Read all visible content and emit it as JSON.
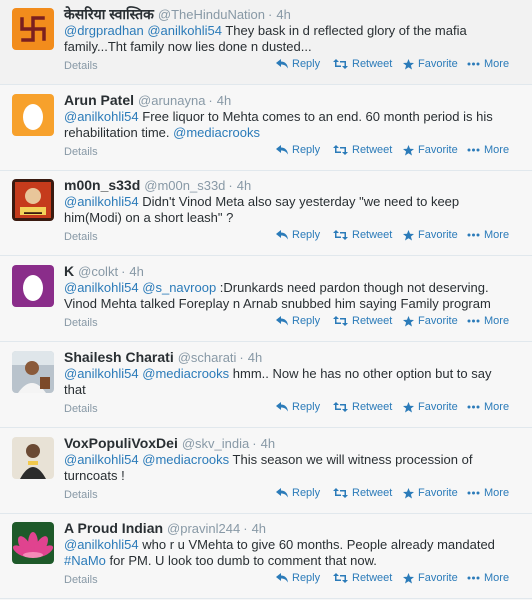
{
  "colors": {
    "link": "#2b7bb9",
    "muted": "#8899a6",
    "text": "#292f33"
  },
  "actions": {
    "reply": "Reply",
    "retweet": "Retweet",
    "favorite": "Favorite",
    "more": "More",
    "details": "Details"
  },
  "tweets": [
    {
      "name": "केसरिया स्वास्तिक",
      "handle": "@TheHinduNation",
      "time": "4h",
      "avatar": "swastika-orange",
      "segments": [
        {
          "t": "@drgpradhan",
          "link": true
        },
        {
          "t": " "
        },
        {
          "t": "@anilkohli54",
          "link": true
        },
        {
          "t": " They bask in d reflected glory of the mafia family...Tht family now lies done n dusted..."
        }
      ]
    },
    {
      "name": "Arun Patel",
      "handle": "@arunayna",
      "time": "4h",
      "avatar": "egg-orange",
      "segments": [
        {
          "t": "@anilkohli54",
          "link": true
        },
        {
          "t": " Free liquor to Mehta comes to an end. 60 month period is his rehabilitation time. "
        },
        {
          "t": "@mediacrooks",
          "link": true
        }
      ]
    },
    {
      "name": "m00n_s33d",
      "handle": "@m00n_s33d",
      "time": "4h",
      "avatar": "photo-poster",
      "segments": [
        {
          "t": "@anilkohli54",
          "link": true
        },
        {
          "t": " Didn't Vinod Meta also say yesterday \"we need to keep him(Modi) on a short leash\" ?"
        }
      ]
    },
    {
      "name": "K",
      "handle": "@colkt",
      "time": "4h",
      "avatar": "egg-purple",
      "segments": [
        {
          "t": "@anilkohli54",
          "link": true
        },
        {
          "t": " "
        },
        {
          "t": "@s_navroop",
          "link": true
        },
        {
          "t": " :Drunkards need pardon though not deserving. Vinod Mehta talked Foreplay n Arnab snubbed him saying Family program"
        }
      ]
    },
    {
      "name": "Shailesh Charati",
      "handle": "@scharati",
      "time": "4h",
      "avatar": "photo-man",
      "segments": [
        {
          "t": "@anilkohli54",
          "link": true
        },
        {
          "t": " "
        },
        {
          "t": "@mediacrooks",
          "link": true
        },
        {
          "t": " hmm.. Now he has  no other option but to say that"
        }
      ]
    },
    {
      "name": "VoxPopuliVoxDei",
      "handle": "@skv_india",
      "time": "4h",
      "avatar": "photo-person",
      "segments": [
        {
          "t": "@anilkohli54",
          "link": true
        },
        {
          "t": " "
        },
        {
          "t": "@mediacrooks",
          "link": true
        },
        {
          "t": " This season we will witness procession of turncoats !"
        }
      ]
    },
    {
      "name": "A Proud Indian",
      "handle": "@pravinl244",
      "time": "4h",
      "avatar": "lotus-pink",
      "segments": [
        {
          "t": "@anilkohli54",
          "link": true
        },
        {
          "t": " who r u VMehta to give 60 months. People already mandated "
        },
        {
          "t": "#NaMo",
          "link": true
        },
        {
          "t": " for PM. U look too dumb to comment that now."
        }
      ]
    }
  ]
}
